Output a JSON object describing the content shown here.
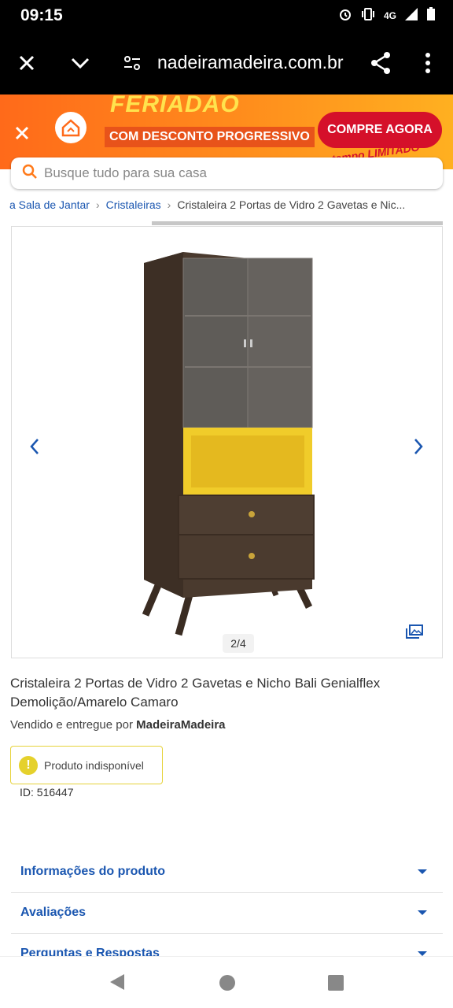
{
  "status": {
    "time": "09:15",
    "network": "4G"
  },
  "browser": {
    "url": "nadeiramadeira.com.br"
  },
  "promo": {
    "title": "FERIADÃO",
    "subtitle": "COM DESCONTO PROGRESSIVO",
    "cta": "COMPRE AGORA",
    "tag": "por tempo LIMITADO"
  },
  "search": {
    "placeholder": "Busque tudo para sua casa"
  },
  "breadcrumb": {
    "item1": "a Sala de Jantar",
    "item2": "Cristaleiras",
    "current": "Cristaleira 2 Portas de Vidro 2 Gavetas e Nic..."
  },
  "gallery": {
    "counter": "2/4"
  },
  "product": {
    "title": "Cristaleira 2 Portas de Vidro 2 Gavetas e Nicho Bali Genialflex Demolição/Amarelo Camaro",
    "seller_prefix": "Vendido e entregue por",
    "seller_name": "MadeiraMadeira",
    "status": "Produto indisponível",
    "id": "ID: 516447"
  },
  "accordion": {
    "info": "Informações do produto",
    "reviews": "Avaliações",
    "qa": "Perguntas e Respostas"
  },
  "colors": {
    "brand_blue": "#1a56b0",
    "promo_orange": "#ff7a1a",
    "cta_red": "#d5102a",
    "warn_yellow": "#e5d12c"
  }
}
